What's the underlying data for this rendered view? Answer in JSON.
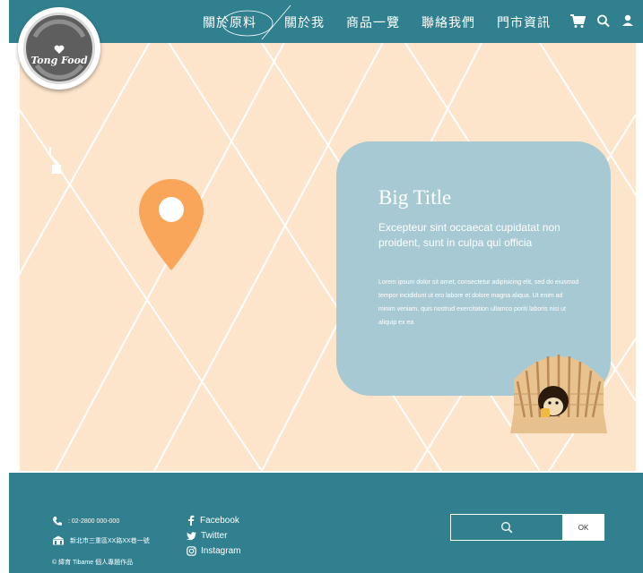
{
  "nav": {
    "items": [
      "關於原料",
      "關於我",
      "商品一覽",
      "聯絡我們",
      "門市資訊"
    ],
    "icons": [
      "cart-icon",
      "search-icon",
      "user-icon"
    ]
  },
  "logo": {
    "text": "Tong Food"
  },
  "card": {
    "title": "Big Title",
    "subtitle": "Excepteur sint occaecat cupidatat non proident, sunt in culpa qui officia",
    "body": "Lorem ipsum dolor sit amet, consectetur adipisicing elit, sed do eiusmod tempor incididunt ut ero labore et dolore magna aliqua. Ut enim ad minim veniam, quis nostrud exercitation ullamco poriti laboris nisi ut aliquip ex ea"
  },
  "footer": {
    "phone": ": 02-2800 000-000",
    "address": "新北市三重區XX路XX巷一號",
    "copyright": "© 緯育 Tibame 個人專題作品",
    "social": [
      "Facebook",
      "Twitter",
      "Instagram"
    ],
    "ok_label": "OK"
  },
  "colors": {
    "teal": "#30808f",
    "peach": "#fde5cc",
    "card": "#a7c9d3",
    "pin": "#f9a65a"
  }
}
